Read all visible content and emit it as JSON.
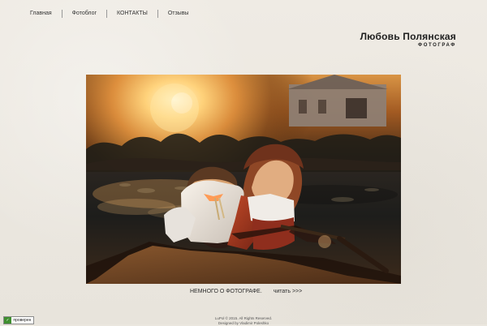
{
  "nav": {
    "items": [
      "Главная",
      "Фотоблог",
      "КОНТАКТЫ",
      "Отзывы"
    ]
  },
  "brand": {
    "name": "Любовь Полянская",
    "subtitle": "ФОТОГРАФ"
  },
  "caption": {
    "about": "НЕМНОГО О ФОТОГРАФЕ.",
    "read": "читать >>>"
  },
  "footer": {
    "line1": "LuPol © 2015. All Rights Reserved.",
    "line2": "Designed by Vladimir Poleshko"
  },
  "badge": {
    "text": "проверен"
  },
  "colors": {
    "background": "#ebe7df",
    "text": "#222222"
  }
}
